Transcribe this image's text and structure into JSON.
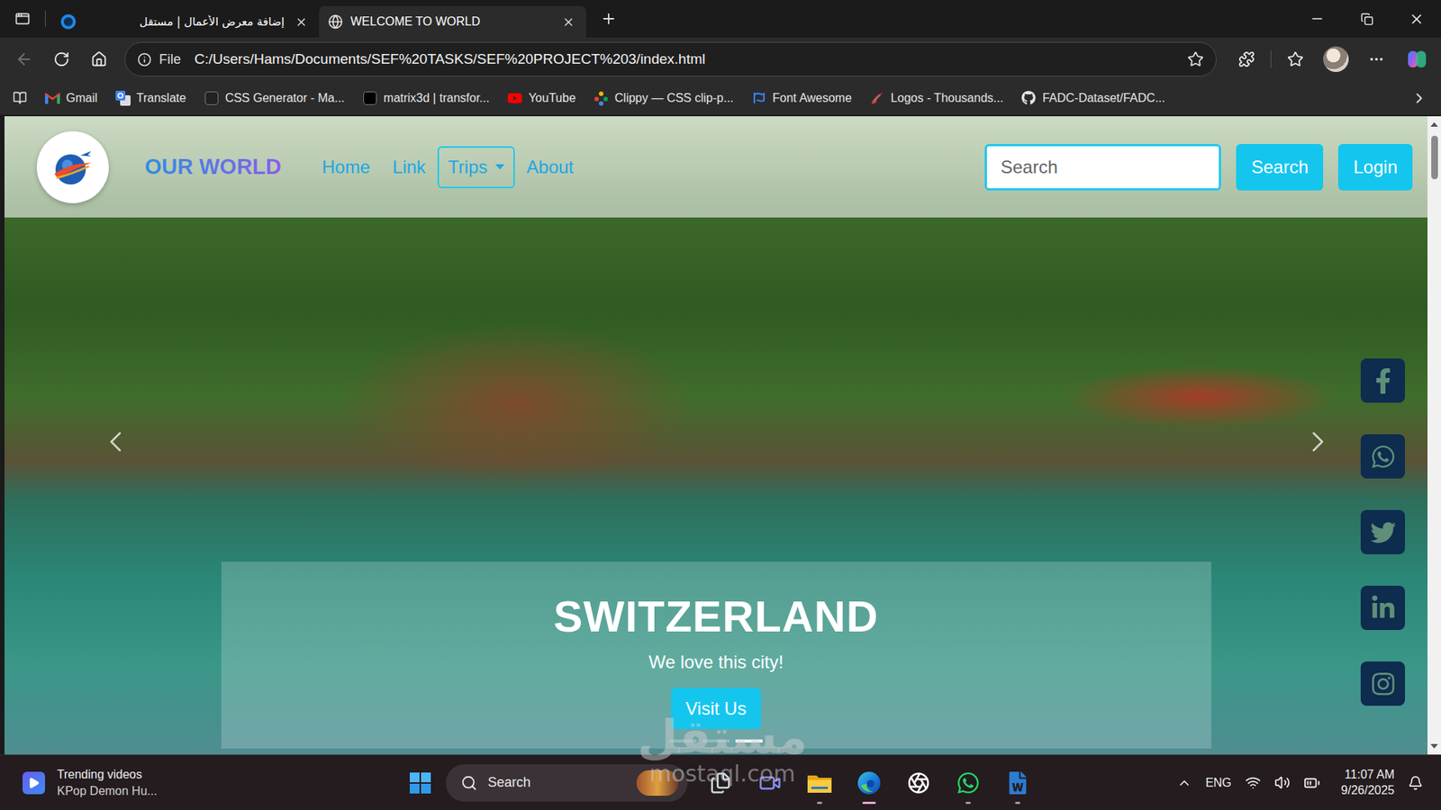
{
  "tabs": [
    {
      "label": "إضافة معرض الأعمال | مستقل",
      "selected": false
    },
    {
      "label": "WELCOME TO WORLD",
      "selected": true
    }
  ],
  "address_bar": {
    "scheme": "File",
    "url": "C:/Users/Hams/Documents/SEF%20TASKS/SEF%20PROJECT%203/index.html",
    "back_disabled": true
  },
  "bookmarks": [
    {
      "label": "Gmail"
    },
    {
      "label": "Translate"
    },
    {
      "label": "CSS Generator - Ma..."
    },
    {
      "label": "matrix3d | transfor..."
    },
    {
      "label": "YouTube"
    },
    {
      "label": "Clippy — CSS clip-p..."
    },
    {
      "label": "Font Awesome"
    },
    {
      "label": "Logos - Thousands..."
    },
    {
      "label": "FADC-Dataset/FADC..."
    }
  ],
  "page": {
    "brand": "OUR WORLD",
    "nav": [
      {
        "label": "Home",
        "dropdown": false,
        "focused": false
      },
      {
        "label": "Link",
        "dropdown": false,
        "focused": false
      },
      {
        "label": "Trips",
        "dropdown": true,
        "focused": true
      },
      {
        "label": "About",
        "dropdown": false,
        "focused": false
      }
    ],
    "search": {
      "placeholder": "Search",
      "button": "Search"
    },
    "login": "Login",
    "slide": {
      "title": "SWITZERLAND",
      "text": "We love this city!",
      "button": "Visit Us"
    },
    "indicators": [
      {
        "selected": false
      },
      {
        "selected": false
      },
      {
        "selected": true
      }
    ]
  },
  "watermark": {
    "title": "مستقل",
    "url": "mostaql.com"
  },
  "taskbar": {
    "widget": {
      "title": "Trending videos",
      "subtitle": "KPop Demon Hu..."
    },
    "search": "Search",
    "apps": [
      {
        "running": false,
        "active": false
      },
      {
        "running": false,
        "active": false
      },
      {
        "running": true,
        "active": false
      },
      {
        "running": true,
        "active": true
      },
      {
        "running": false,
        "active": false
      },
      {
        "running": true,
        "active": false
      },
      {
        "running": true,
        "active": false
      }
    ],
    "tray": {
      "language": "ENG",
      "time": "11:07 AM",
      "date": "9/26/2025"
    }
  }
}
